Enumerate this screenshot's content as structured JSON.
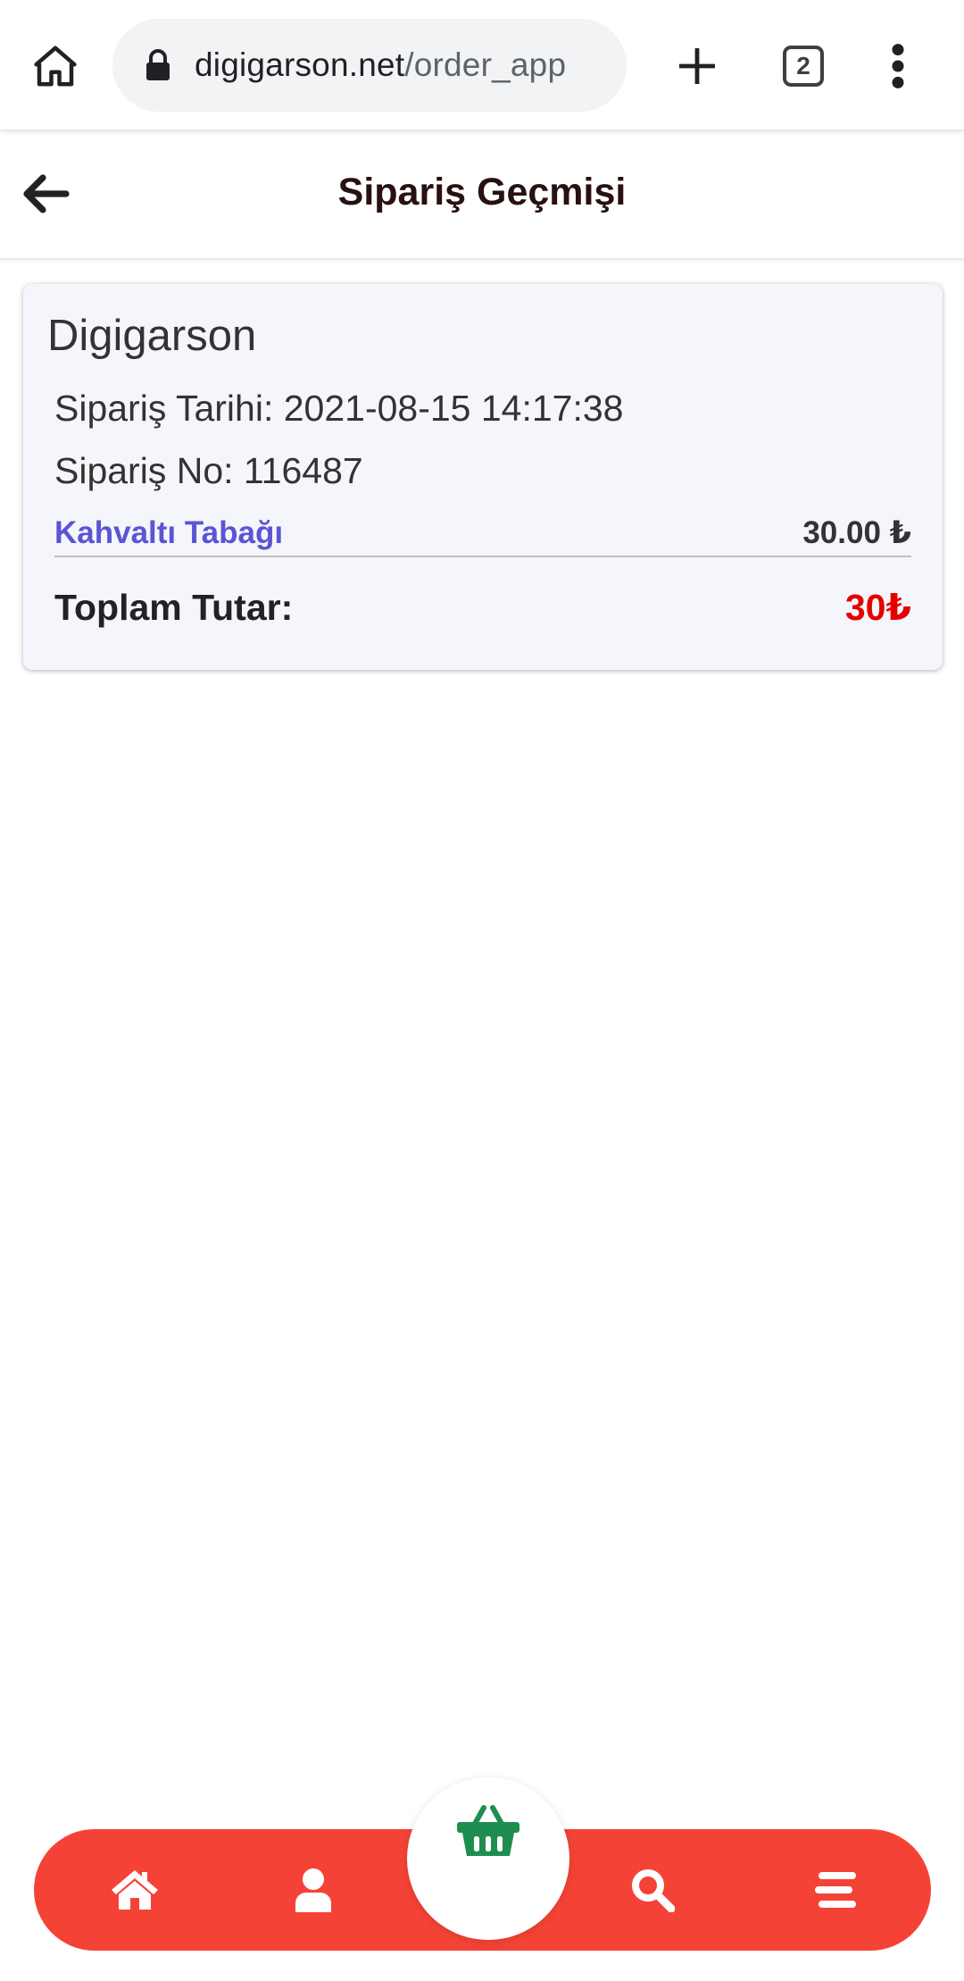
{
  "browser": {
    "url_domain": "digigarson.net",
    "url_path": "/order_app",
    "tab_count": "2"
  },
  "header": {
    "title": "Sipariş Geçmişi"
  },
  "order": {
    "restaurant": "Digigarson",
    "date_line": "Sipariş Tarihi: 2021-08-15 14:17:38",
    "number_line": "Sipariş No: 116487",
    "items": [
      {
        "name": "Kahvaltı Tabağı",
        "price": "30.00 ₺"
      }
    ],
    "total_label": "Toplam Tutar:",
    "total_value": "30₺"
  },
  "colors": {
    "accent": "#f44336",
    "basket": "#1e8e4e",
    "item_link": "#5a55d6",
    "total": "#e60000"
  },
  "nav": {
    "icons": [
      "home-icon",
      "user-icon",
      "basket-icon",
      "search-icon",
      "menu-icon"
    ]
  }
}
